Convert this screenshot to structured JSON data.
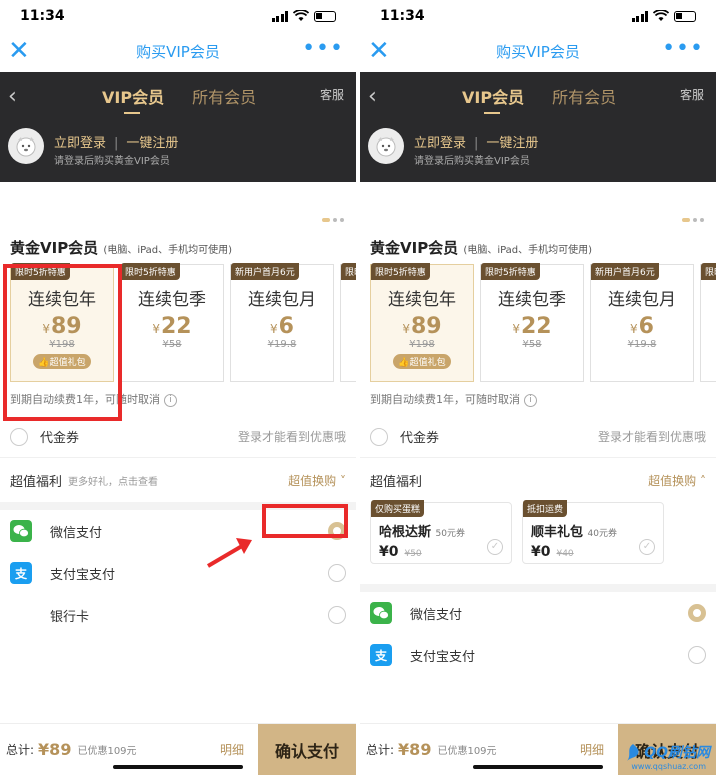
{
  "status": {
    "time": "11:34"
  },
  "nav": {
    "close": "✕",
    "title": "购买VIP会员",
    "more": "•••"
  },
  "header": {
    "back": "‹",
    "tabs": [
      {
        "label": "VIP会员",
        "active": true
      },
      {
        "label": "所有会员",
        "active": false
      }
    ],
    "service": "客服",
    "login": "立即登录",
    "separator": "|",
    "register": "一键注册",
    "login_hint": "请登录后购买黄金VIP会员"
  },
  "section": {
    "title": "黄金VIP会员",
    "subtitle": "(电脑、iPad、手机均可使用)"
  },
  "packages": [
    {
      "tag": "限时5折特惠",
      "name": "连续包年",
      "currency": "¥",
      "price": "89",
      "original": "¥198",
      "gift": "超值礼包",
      "selected": true
    },
    {
      "tag": "限时5折特惠",
      "name": "连续包季",
      "currency": "¥",
      "price": "22",
      "original": "¥58",
      "selected": false
    },
    {
      "tag": "新用户首月6元",
      "name": "连续包月",
      "currency": "¥",
      "price": "6",
      "original": "¥19.8",
      "selected": false
    },
    {
      "tag": "限时",
      "name": "",
      "currency": "",
      "price": "",
      "original": "",
      "selected": false
    }
  ],
  "renew_note": "到期自动续费1年，可随时取消",
  "info_glyph": "i",
  "voucher": {
    "label": "代金券",
    "hint": "登录才能看到优惠哦"
  },
  "benefits": {
    "label": "超值福利",
    "sub": "更多好礼，点击查看",
    "link_collapsed": "超值换购 ˅",
    "link_expanded": "超值换购 ˄"
  },
  "coupons": [
    {
      "tag": "仅购买蛋糕",
      "name": "哈根达斯",
      "note": "50元券",
      "price": "¥0",
      "original": "¥50"
    },
    {
      "tag": "抵扣运费",
      "name": "顺丰礼包",
      "note": "40元券",
      "price": "¥0",
      "original": "¥40"
    }
  ],
  "check_glyph": "✓",
  "payments": [
    {
      "label": "微信支付",
      "color": "#3bb34a",
      "selected": true
    },
    {
      "label": "支付宝支付",
      "color": "#1a9ef0",
      "selected": false
    },
    {
      "label": "银行卡",
      "color": "",
      "selected": false
    }
  ],
  "alipay_glyph": "支",
  "bottom": {
    "total_label": "总计:",
    "total": "¥89",
    "saved": "已优惠109元",
    "detail": "明细",
    "confirm": "确认支付"
  },
  "watermark": {
    "main": "QQ刷钻网",
    "sub": "www.qqshuaz.com"
  },
  "colors": {
    "accent": "#2a9bf0",
    "gold": "#b5925a",
    "highlight": "#e92a2a"
  }
}
